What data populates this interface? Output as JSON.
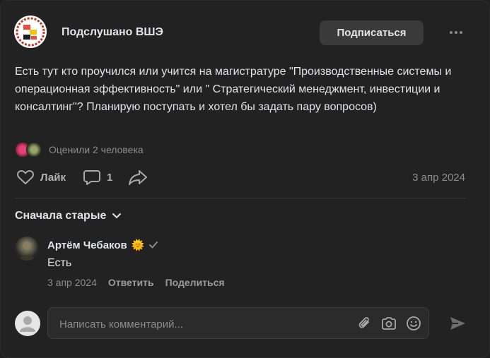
{
  "group": {
    "name": "Подслушано ВШЭ",
    "subscribe_label": "Подписаться"
  },
  "post": {
    "text": "Есть тут кто проучился или учится на магистратуре \"Производственные системы и операционная эффективность\" или \" Стратегический менеджмент, инвестиции и консалтинг\"? Планирую поступать и хотел бы задать пару вопросов)",
    "likes_text": "Оценили 2 человека",
    "like_label": "Лайк",
    "comments_count": "1",
    "date": "3 апр 2024"
  },
  "comments": {
    "sort_label": "Сначала старые",
    "items": [
      {
        "author": "Артём Чебаков",
        "emoji": "🌞",
        "text": "Есть",
        "date": "3 апр 2024",
        "reply_label": "Ответить",
        "share_label": "Поделиться"
      }
    ]
  },
  "composer": {
    "placeholder": "Написать комментарий..."
  },
  "icons": {
    "more": "more-dots-icon",
    "like": "heart-icon",
    "comment": "comment-bubble-icon",
    "share": "share-arrow-icon",
    "chevron": "chevron-down-icon",
    "verified": "check-icon",
    "attach": "paperclip-icon",
    "camera": "camera-icon",
    "emoji": "smile-icon",
    "send": "send-icon"
  },
  "colors": {
    "background": "#222222",
    "text": "#e1e3e6",
    "secondary": "#8c8c8c",
    "button_bg": "#3a3a3a"
  }
}
